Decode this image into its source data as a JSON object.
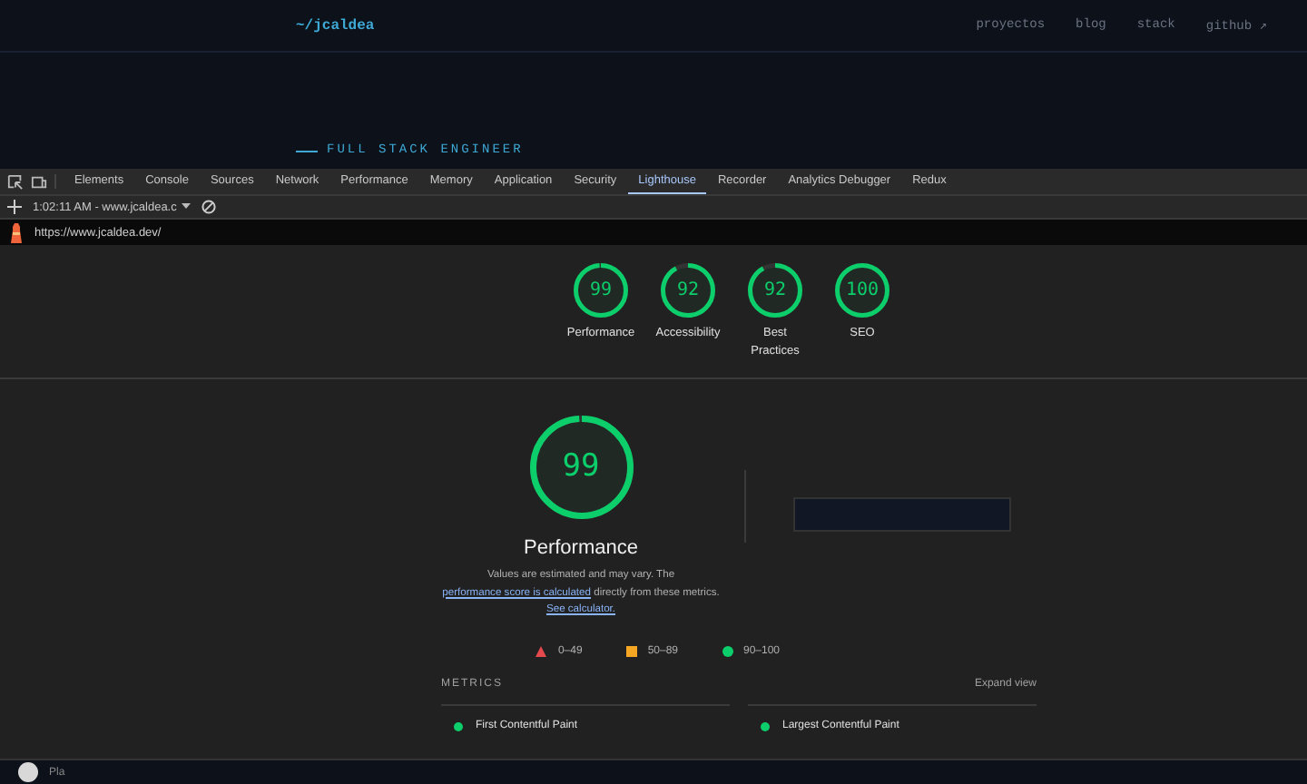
{
  "site": {
    "logo": "~/jcaldea",
    "nav": [
      {
        "label": "proyectos"
      },
      {
        "label": "blog"
      },
      {
        "label": "stack"
      },
      {
        "label": "github ↗"
      }
    ],
    "subtitle": "FULL STACK ENGINEER"
  },
  "devtools": {
    "tabs": [
      {
        "label": "Elements",
        "selected": false
      },
      {
        "label": "Console",
        "selected": false
      },
      {
        "label": "Sources",
        "selected": false
      },
      {
        "label": "Network",
        "selected": false
      },
      {
        "label": "Performance",
        "selected": false
      },
      {
        "label": "Memory",
        "selected": false
      },
      {
        "label": "Application",
        "selected": false
      },
      {
        "label": "Security",
        "selected": false
      },
      {
        "label": "Lighthouse",
        "selected": true
      },
      {
        "label": "Recorder",
        "selected": false
      },
      {
        "label": "Analytics Debugger",
        "selected": false
      },
      {
        "label": "Redux",
        "selected": false
      }
    ],
    "session": "1:02:11 AM - www.jcaldea.c",
    "url": "https://www.jcaldea.dev/"
  },
  "report": {
    "gauges": [
      {
        "score": "99",
        "label": "Performance",
        "level": 0.99
      },
      {
        "score": "92",
        "label": "Accessibility",
        "level": 0.92
      },
      {
        "score": "92",
        "label": "Best Practices",
        "level": 0.92
      },
      {
        "score": "100",
        "label": "SEO",
        "level": 1
      }
    ],
    "main": {
      "score": "99",
      "level": 0.99,
      "title": "Performance",
      "description": [
        {
          "kind": "text",
          "text": "Values are estimated and may vary. The "
        },
        {
          "kind": "link",
          "text": "performance score is calculated"
        },
        {
          "kind": "text",
          "text": " directly from these metrics. "
        },
        {
          "kind": "link",
          "text": "See calculator."
        }
      ]
    },
    "legend": [
      {
        "kind": "triangle",
        "color": "#e5484d",
        "label": "0–49"
      },
      {
        "kind": "square",
        "color": "#f5a623",
        "label": "50–89"
      },
      {
        "kind": "circle",
        "color": "#0cce6b",
        "label": "90–100"
      }
    ],
    "metrics": {
      "title": "METRICS",
      "expand": "Expand view",
      "items": [
        {
          "label": "First Contentful Paint",
          "color": "#0cce6b"
        },
        {
          "label": "Largest Contentful Paint",
          "color": "#0cce6b"
        }
      ]
    }
  },
  "taskbar": {
    "label": "Pla"
  }
}
